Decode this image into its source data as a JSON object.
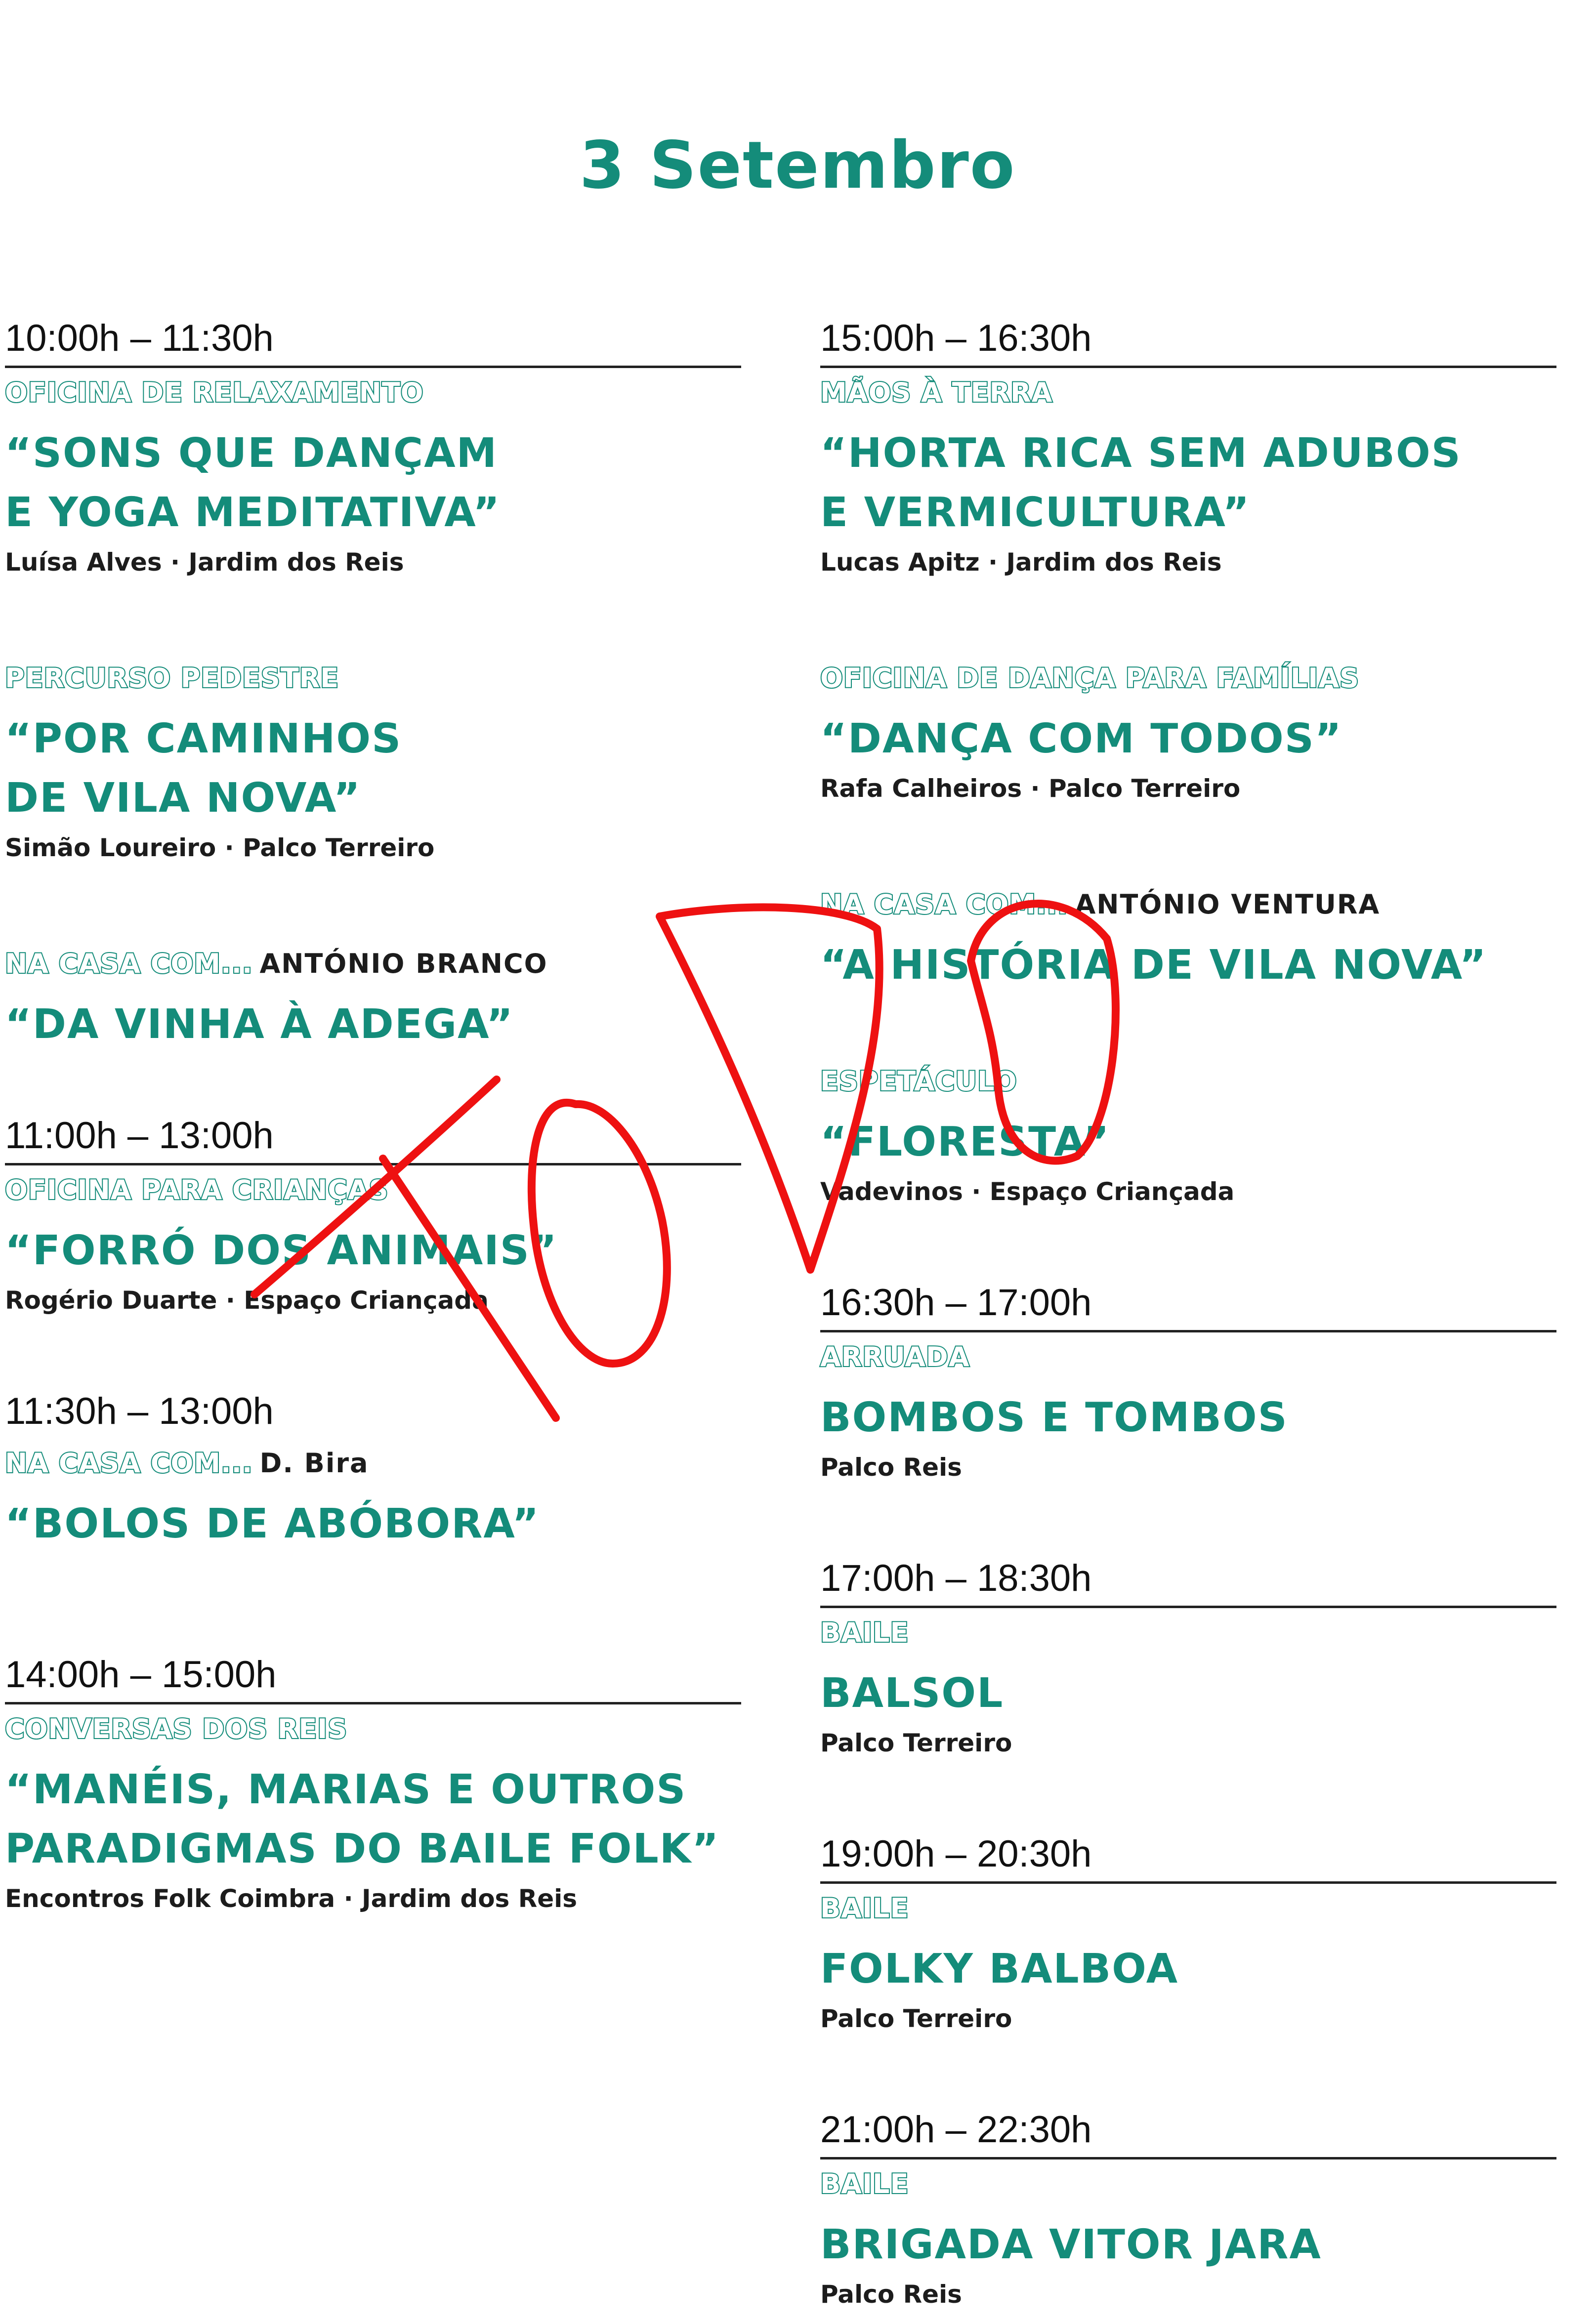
{
  "title": "3 Setembro",
  "left_column": {
    "slot1": {
      "time": "10:00h – 11:30h",
      "event1": {
        "category": "OFICINA DE RELAXAMENTO",
        "title_line1": "“SONS QUE DANÇAM",
        "title_line2": "E YOGA MEDITATIVA”",
        "subtitle": "Luísa Alves · Jardim dos Reis"
      },
      "event2": {
        "category": "PERCURSO PEDESTRE",
        "title_line1": "“POR CAMINHOS",
        "title_line2": "DE VILA NOVA”",
        "subtitle": "Simão Loureiro · Palco Terreiro"
      },
      "event3": {
        "category": "NA CASA COM...",
        "host": "ANTÓNIO BRANCO",
        "title_line1": "“DA VINHA À ADEGA”"
      }
    },
    "slot2": {
      "time": "11:00h – 13:00h",
      "event1": {
        "category": "OFICINA PARA CRIANÇAS",
        "title_line1": "“FORRÓ DOS ANIMAIS”",
        "subtitle": "Rogério Duarte · Espaço Criançada"
      }
    },
    "slot3": {
      "time": "11:30h – 13:00h",
      "event1": {
        "category": "NA CASA COM...",
        "host": "D. Bira",
        "title_line1": "“BOLOS DE ABÓBORA”"
      }
    },
    "slot4": {
      "time": "14:00h – 15:00h",
      "event1": {
        "category": "CONVERSAS DOS REIS",
        "title_line1": "“MANÉIS, MARIAS E OUTROS",
        "title_line2": "PARADIGMAS DO BAILE FOLK”",
        "subtitle": "Encontros Folk Coimbra · Jardim dos Reis"
      }
    }
  },
  "right_column": {
    "slot1": {
      "time": "15:00h – 16:30h",
      "event1": {
        "category": "MÃOS À TERRA",
        "title_line1": "“HORTA RICA SEM ADUBOS",
        "title_line2": "E VERMICULTURA”",
        "subtitle": "Lucas Apitz · Jardim dos Reis"
      },
      "event2": {
        "category": "OFICINA DE DANÇA PARA FAMÍLIAS",
        "title_line1": "“DANÇA COM TODOS”",
        "subtitle": "Rafa Calheiros · Palco Terreiro"
      },
      "event3": {
        "category": "NA CASA COM...",
        "host": "ANTÓNIO VENTURA",
        "title_line1": "“A HISTÓRIA DE VILA NOVA”"
      },
      "event4": {
        "category": "ESPETÁCULO",
        "title_line1": "“FLORESTA”",
        "subtitle": "Vadevinos · Espaço Criançada"
      }
    },
    "slot2": {
      "time": "16:30h – 17:00h",
      "event1": {
        "category": "ARRUADA",
        "title_line1": "BOMBOS E TOMBOS",
        "subtitle": "Palco Reis"
      }
    },
    "slot3": {
      "time": "17:00h – 18:30h",
      "event1": {
        "category": "BAILE",
        "title_line1": "BALSOL",
        "subtitle": "Palco Terreiro"
      }
    },
    "slot4": {
      "time": "19:00h – 20:30h",
      "event1": {
        "category": "BAILE",
        "title_line1": "FOLKY BALBOA",
        "subtitle": "Palco Terreiro"
      }
    },
    "slot5": {
      "time": "21:00h – 22:30h",
      "event1": {
        "category": "BAILE",
        "title_line1": "BRIGADA VITOR JARA",
        "subtitle": "Palco Reis"
      }
    }
  },
  "annotation": {
    "text": "TODO",
    "color": "#EE1111"
  },
  "colors": {
    "accent": "#148C7A",
    "text": "#1c1c1c"
  }
}
